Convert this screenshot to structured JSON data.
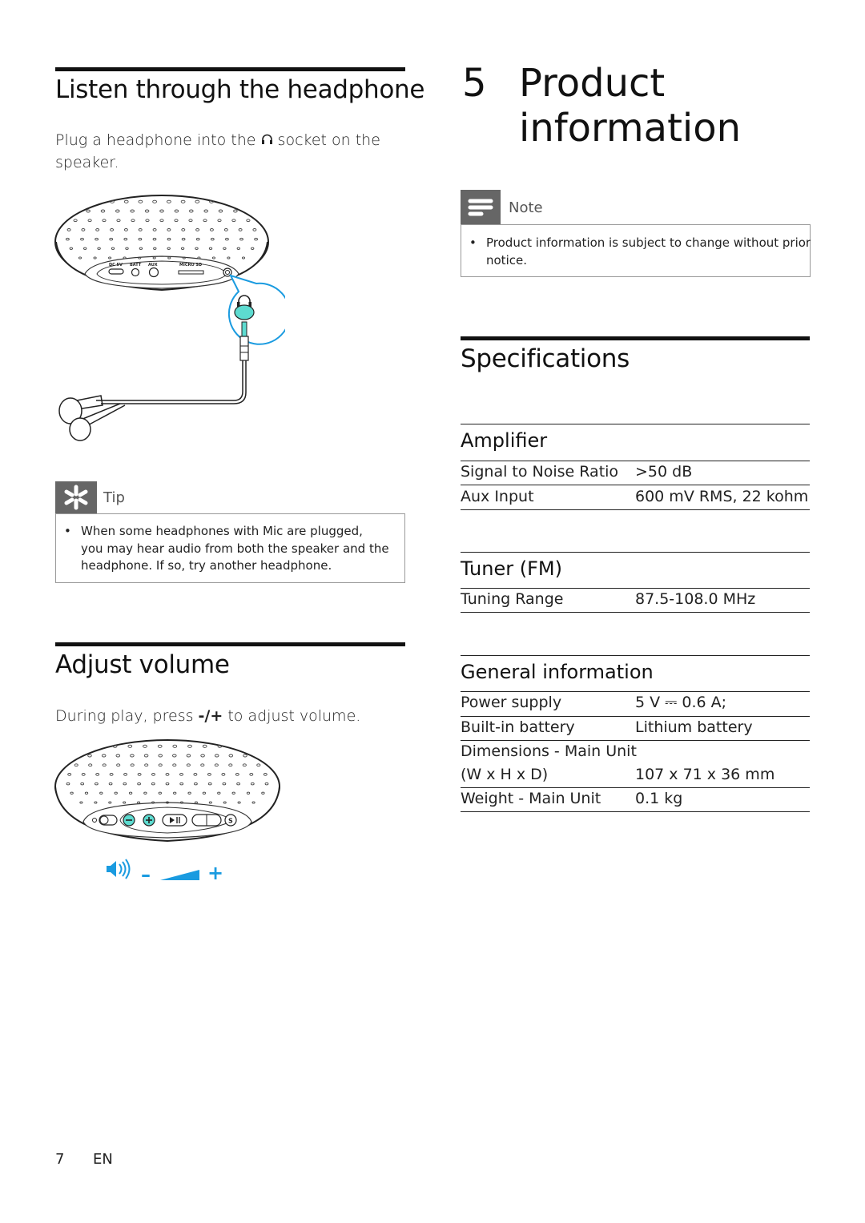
{
  "left_column": {
    "headphone_section": {
      "title": "Listen through the headphone",
      "instruction_before_icon": "Plug a headphone into the",
      "instruction_after_icon": "socket on the",
      "instruction_line2": "speaker.",
      "illustration": {
        "port_labels": [
          "DC 5V",
          "BATT",
          "AUX",
          "MICRO SD"
        ],
        "highlight_color": "#1a9be0",
        "jack_color": "#5ddbd0"
      }
    },
    "tip_box": {
      "label": "Tip",
      "icon": "asterisk-tip-icon",
      "bullets": [
        {
          "lines": [
            "When some headphones with Mic are plugged,",
            "you may hear audio from both the speaker and the",
            "headphone. If so, try another headphone."
          ]
        }
      ]
    },
    "volume_section": {
      "title": "Adjust volume",
      "instruction_prefix": "During play, press",
      "instruction_keys": "-/+",
      "instruction_suffix": "to adjust volume.",
      "illustration": {
        "volume_minus": "–",
        "volume_plus": "+",
        "accent_color": "#1a9be0",
        "button_highlight_color": "#5ddbd0"
      }
    }
  },
  "right_column": {
    "chapter": {
      "number": "5",
      "title_line1": "Product",
      "title_line2": "information"
    },
    "note_box": {
      "label": "Note",
      "icon": "note-lines-icon",
      "bullets": [
        {
          "lines": [
            "Product information is subject to change without prior",
            "notice."
          ]
        }
      ]
    },
    "specifications": {
      "title": "Specifications",
      "groups": [
        {
          "heading": "Amplifier",
          "rows": [
            {
              "label": "Signal to Noise Ratio",
              "value": ">50 dB"
            },
            {
              "label": "Aux Input",
              "value": "600 mV RMS, 22 kohm"
            }
          ]
        },
        {
          "heading": "Tuner (FM)",
          "rows": [
            {
              "label": "Tuning Range",
              "value": "87.5-108.0 MHz"
            }
          ]
        },
        {
          "heading": "General information",
          "rows": [
            {
              "label": "Power supply",
              "value": "5 V ⎓ 0.6 A;"
            },
            {
              "label": "Built-in battery",
              "value": "Lithium battery"
            },
            {
              "label": "Dimensions - Main Unit",
              "label_line2": "(W x H x D)",
              "value": "107 x 71 x 36 mm"
            },
            {
              "label": "Weight - Main Unit",
              "value": "0.1 kg"
            }
          ]
        }
      ]
    }
  },
  "footer": {
    "page_number": "7",
    "language": "EN"
  }
}
